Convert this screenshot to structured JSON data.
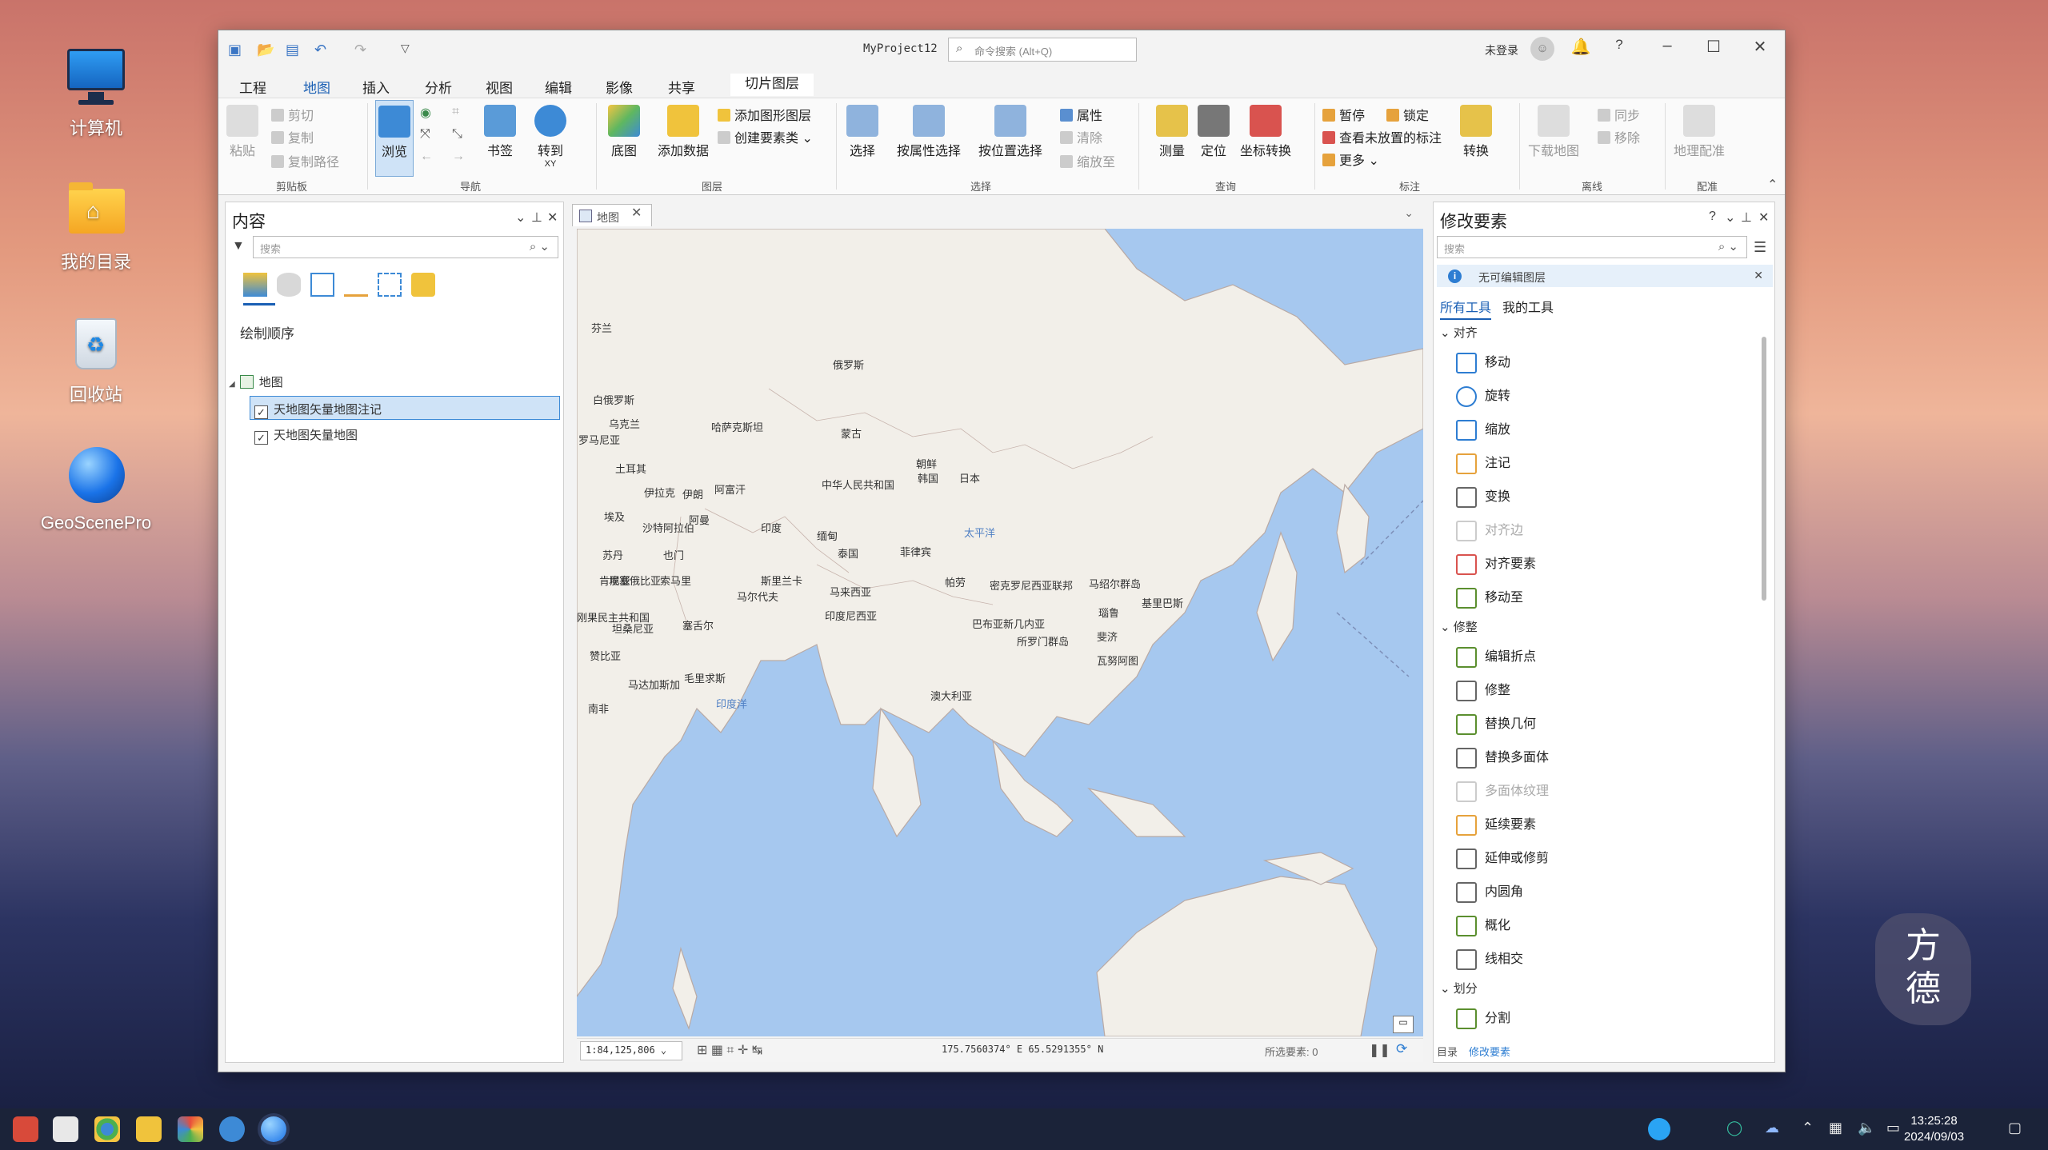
{
  "desktop": {
    "icons": [
      {
        "label": "计算机"
      },
      {
        "label": "我的目录"
      },
      {
        "label": "回收站"
      },
      {
        "label": "GeoScenePro"
      }
    ]
  },
  "window": {
    "title": "MyProject12",
    "search_placeholder": "命令搜索 (Alt+Q)",
    "login": "未登录"
  },
  "ribbon_tabs": [
    "工程",
    "地图",
    "插入",
    "分析",
    "视图",
    "编辑",
    "影像",
    "共享",
    "切片图层"
  ],
  "ribbon": {
    "clipboard": {
      "paste": "粘贴",
      "cut": "剪切",
      "copy": "复制",
      "copy_path": "复制路径",
      "group": "剪贴板"
    },
    "nav": {
      "browse": "浏览",
      "bookmark": "书签",
      "goto": "转到",
      "goto_sub": "XY",
      "group": "导航"
    },
    "layer": {
      "basemap": "底图",
      "add_data": "添加数据",
      "add_graphics": "添加图形图层",
      "create_feature": "创建要素类",
      "group": "图层"
    },
    "select": {
      "select": "选择",
      "by_attr": "按属性选择",
      "by_loc": "按位置选择",
      "attributes": "属性",
      "clear": "清除",
      "zoom_to": "缩放至",
      "group": "选择"
    },
    "query": {
      "measure": "测量",
      "locate": "定位",
      "coord_convert": "坐标转换",
      "group": "查询"
    },
    "label": {
      "pause": "暂停",
      "lock": "锁定",
      "view_unplaced": "查看未放置的标注",
      "more": "更多",
      "convert": "转换",
      "group": "标注"
    },
    "offline": {
      "download": "下载地图",
      "sync": "同步",
      "remove": "移除",
      "group": "离线"
    },
    "georef": {
      "georef": "地理配准",
      "group": "配准"
    }
  },
  "contents": {
    "title": "内容",
    "search_placeholder": "搜索",
    "draw_order": "绘制顺序",
    "map_node": "地图",
    "layers": [
      "天地图矢量地图注记",
      "天地图矢量地图"
    ]
  },
  "map": {
    "tab": "地图",
    "scale": "1:84,125,806",
    "coords": "175.7560374° E 65.5291355° N",
    "selected": "所选要素: 0",
    "labels": [
      "芬兰",
      "俄罗斯",
      "白俄罗斯",
      "乌克兰",
      "罗马尼亚",
      "哈萨克斯坦",
      "蒙古",
      "朝鲜",
      "韩国",
      "日本",
      "土耳其",
      "伊拉克",
      "伊朗",
      "阿富汗",
      "中华人民共和国",
      "埃及",
      "沙特阿拉伯",
      "阿曼",
      "印度",
      "缅甸",
      "泰国",
      "菲律宾",
      "太平洋",
      "苏丹",
      "也门",
      "埃塞俄比亚",
      "索马里",
      "肯尼亚",
      "斯里兰卡",
      "马尔代夫",
      "马来西亚",
      "印度尼西亚",
      "帕劳",
      "密克罗尼西亚联邦",
      "马绍尔群岛",
      "基里巴斯",
      "瑙鲁",
      "巴布亚新几内亚",
      "所罗门群岛",
      "瓦努阿图",
      "斐济",
      "刚果民主共和国",
      "坦桑尼亚",
      "塞舌尔",
      "马达加斯加",
      "毛里求斯",
      "赞比亚",
      "南非",
      "澳大利亚",
      "印度洋"
    ]
  },
  "modify": {
    "title": "修改要素",
    "search_placeholder": "搜索",
    "notice": "无可编辑图层",
    "tabs": [
      "所有工具",
      "我的工具"
    ],
    "groups": [
      {
        "name": "对齐",
        "tools": [
          "移动",
          "旋转",
          "缩放",
          "注记",
          "变换",
          "对齐边",
          "对齐要素",
          "移动至"
        ]
      },
      {
        "name": "修整",
        "tools": [
          "编辑折点",
          "修整",
          "替换几何",
          "替换多面体",
          "多面体纹理",
          "延续要素",
          "延伸或修剪",
          "内圆角",
          "概化",
          "线相交"
        ]
      },
      {
        "name": "划分",
        "tools": [
          "分割"
        ]
      }
    ],
    "bottom_tabs": [
      "目录",
      "修改要素"
    ]
  },
  "taskbar": {
    "time": "13:25:28",
    "date": "2024/09/03"
  },
  "watermark": "方德"
}
